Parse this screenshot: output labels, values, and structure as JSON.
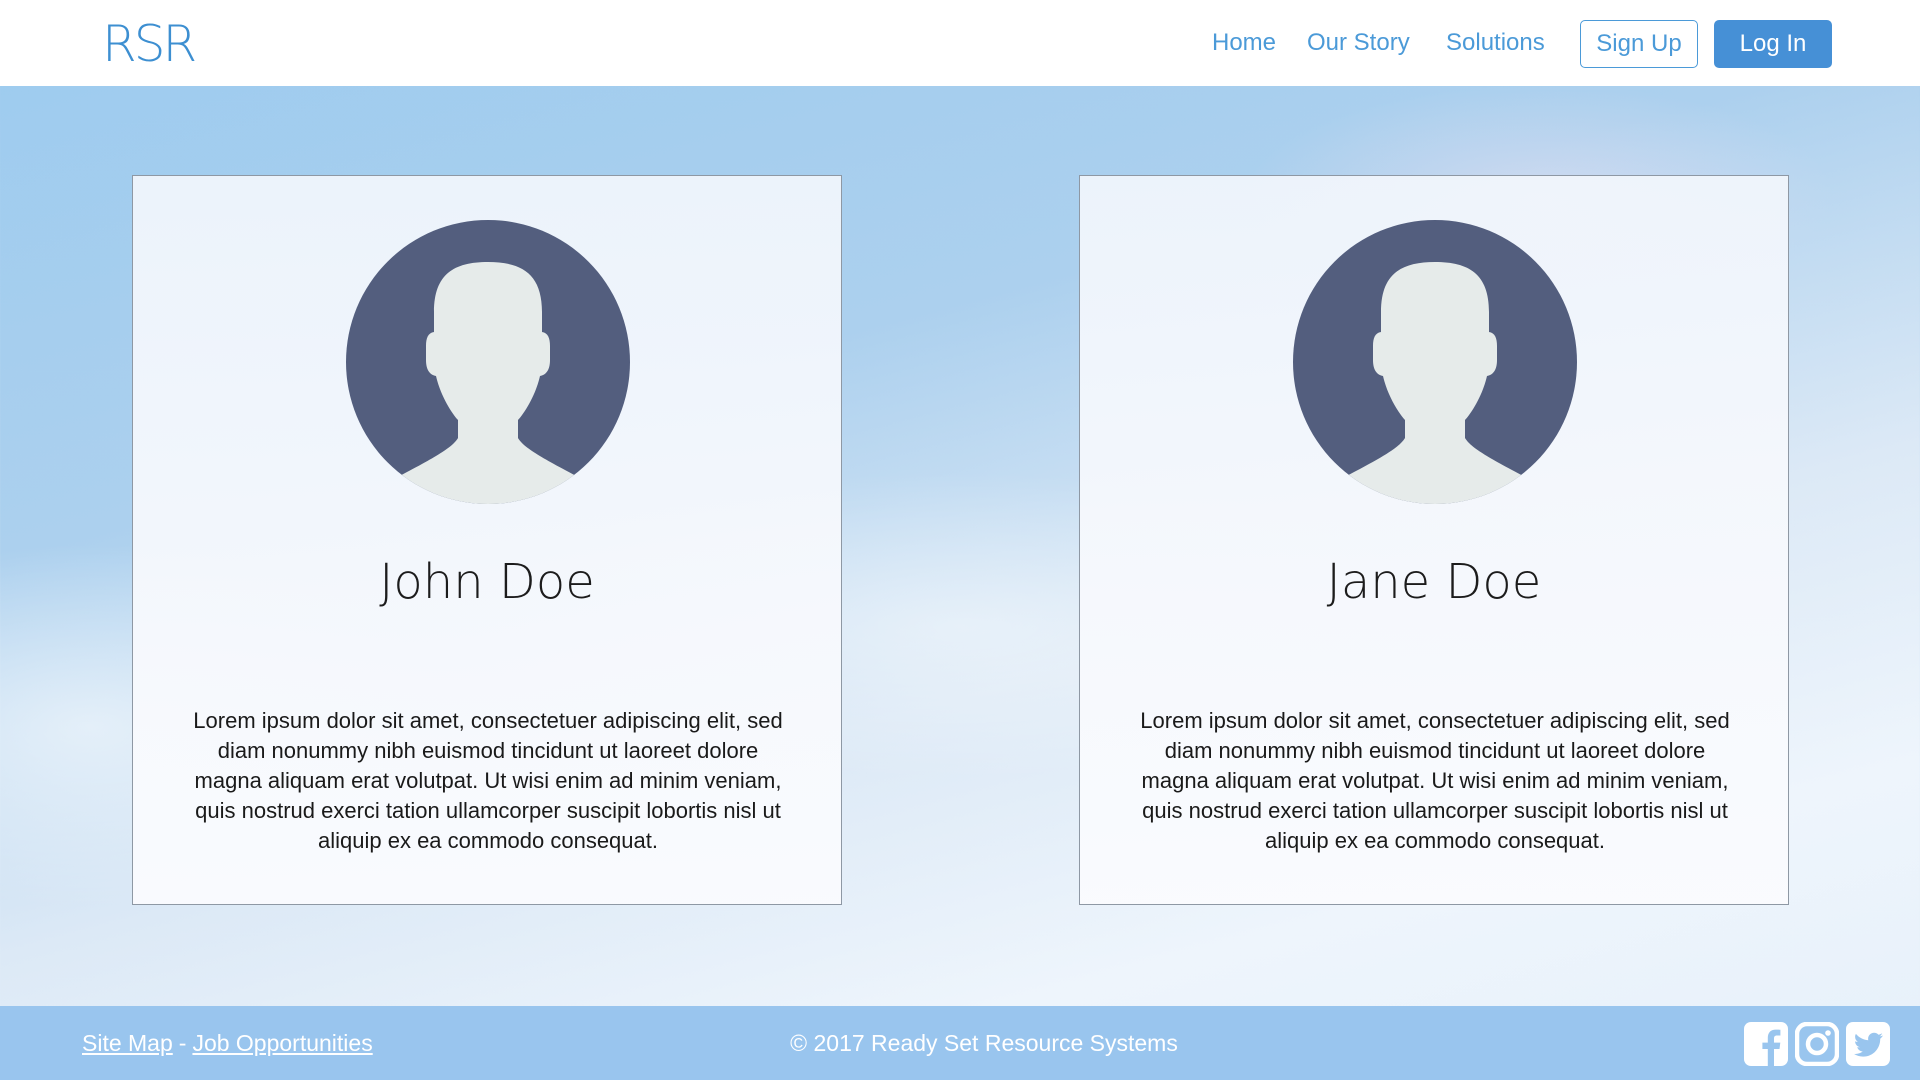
{
  "header": {
    "logo": "RSR",
    "nav": {
      "home": "Home",
      "story": "Our Story",
      "solutions": "Solutions"
    },
    "signup_label": "Sign Up",
    "login_label": "Log In"
  },
  "cards": [
    {
      "name": "John Doe",
      "description": "Lorem ipsum dolor sit amet, consectetuer adipiscing elit, sed diam nonummy nibh euismod tincidunt ut laoreet dolore magna aliquam erat volutpat. Ut wisi enim ad minim veniam, quis nostrud exerci tation ullamcorper suscipit lobortis nisl ut aliquip ex ea commodo consequat."
    },
    {
      "name": "Jane Doe",
      "description": "Lorem ipsum dolor sit amet, consectetuer adipiscing elit, sed diam nonummy nibh euismod tincidunt ut laoreet dolore magna aliquam erat volutpat. Ut wisi enim ad minim veniam, quis nostrud exerci tation ullamcorper suscipit lobortis nisl ut aliquip ex ea commodo consequat."
    }
  ],
  "footer": {
    "site_map": "Site Map",
    "separator": "-",
    "jobs": "Job Opportunities",
    "copyright": "© 2017 Ready Set Resource Systems",
    "social_icons": [
      "facebook-icon",
      "instagram-icon",
      "twitter-icon"
    ]
  },
  "colors": {
    "accent": "#4690d6",
    "avatar_bg": "#535e7e",
    "avatar_figure": "#e6ebea",
    "footer_bg": "#99c5ee"
  }
}
